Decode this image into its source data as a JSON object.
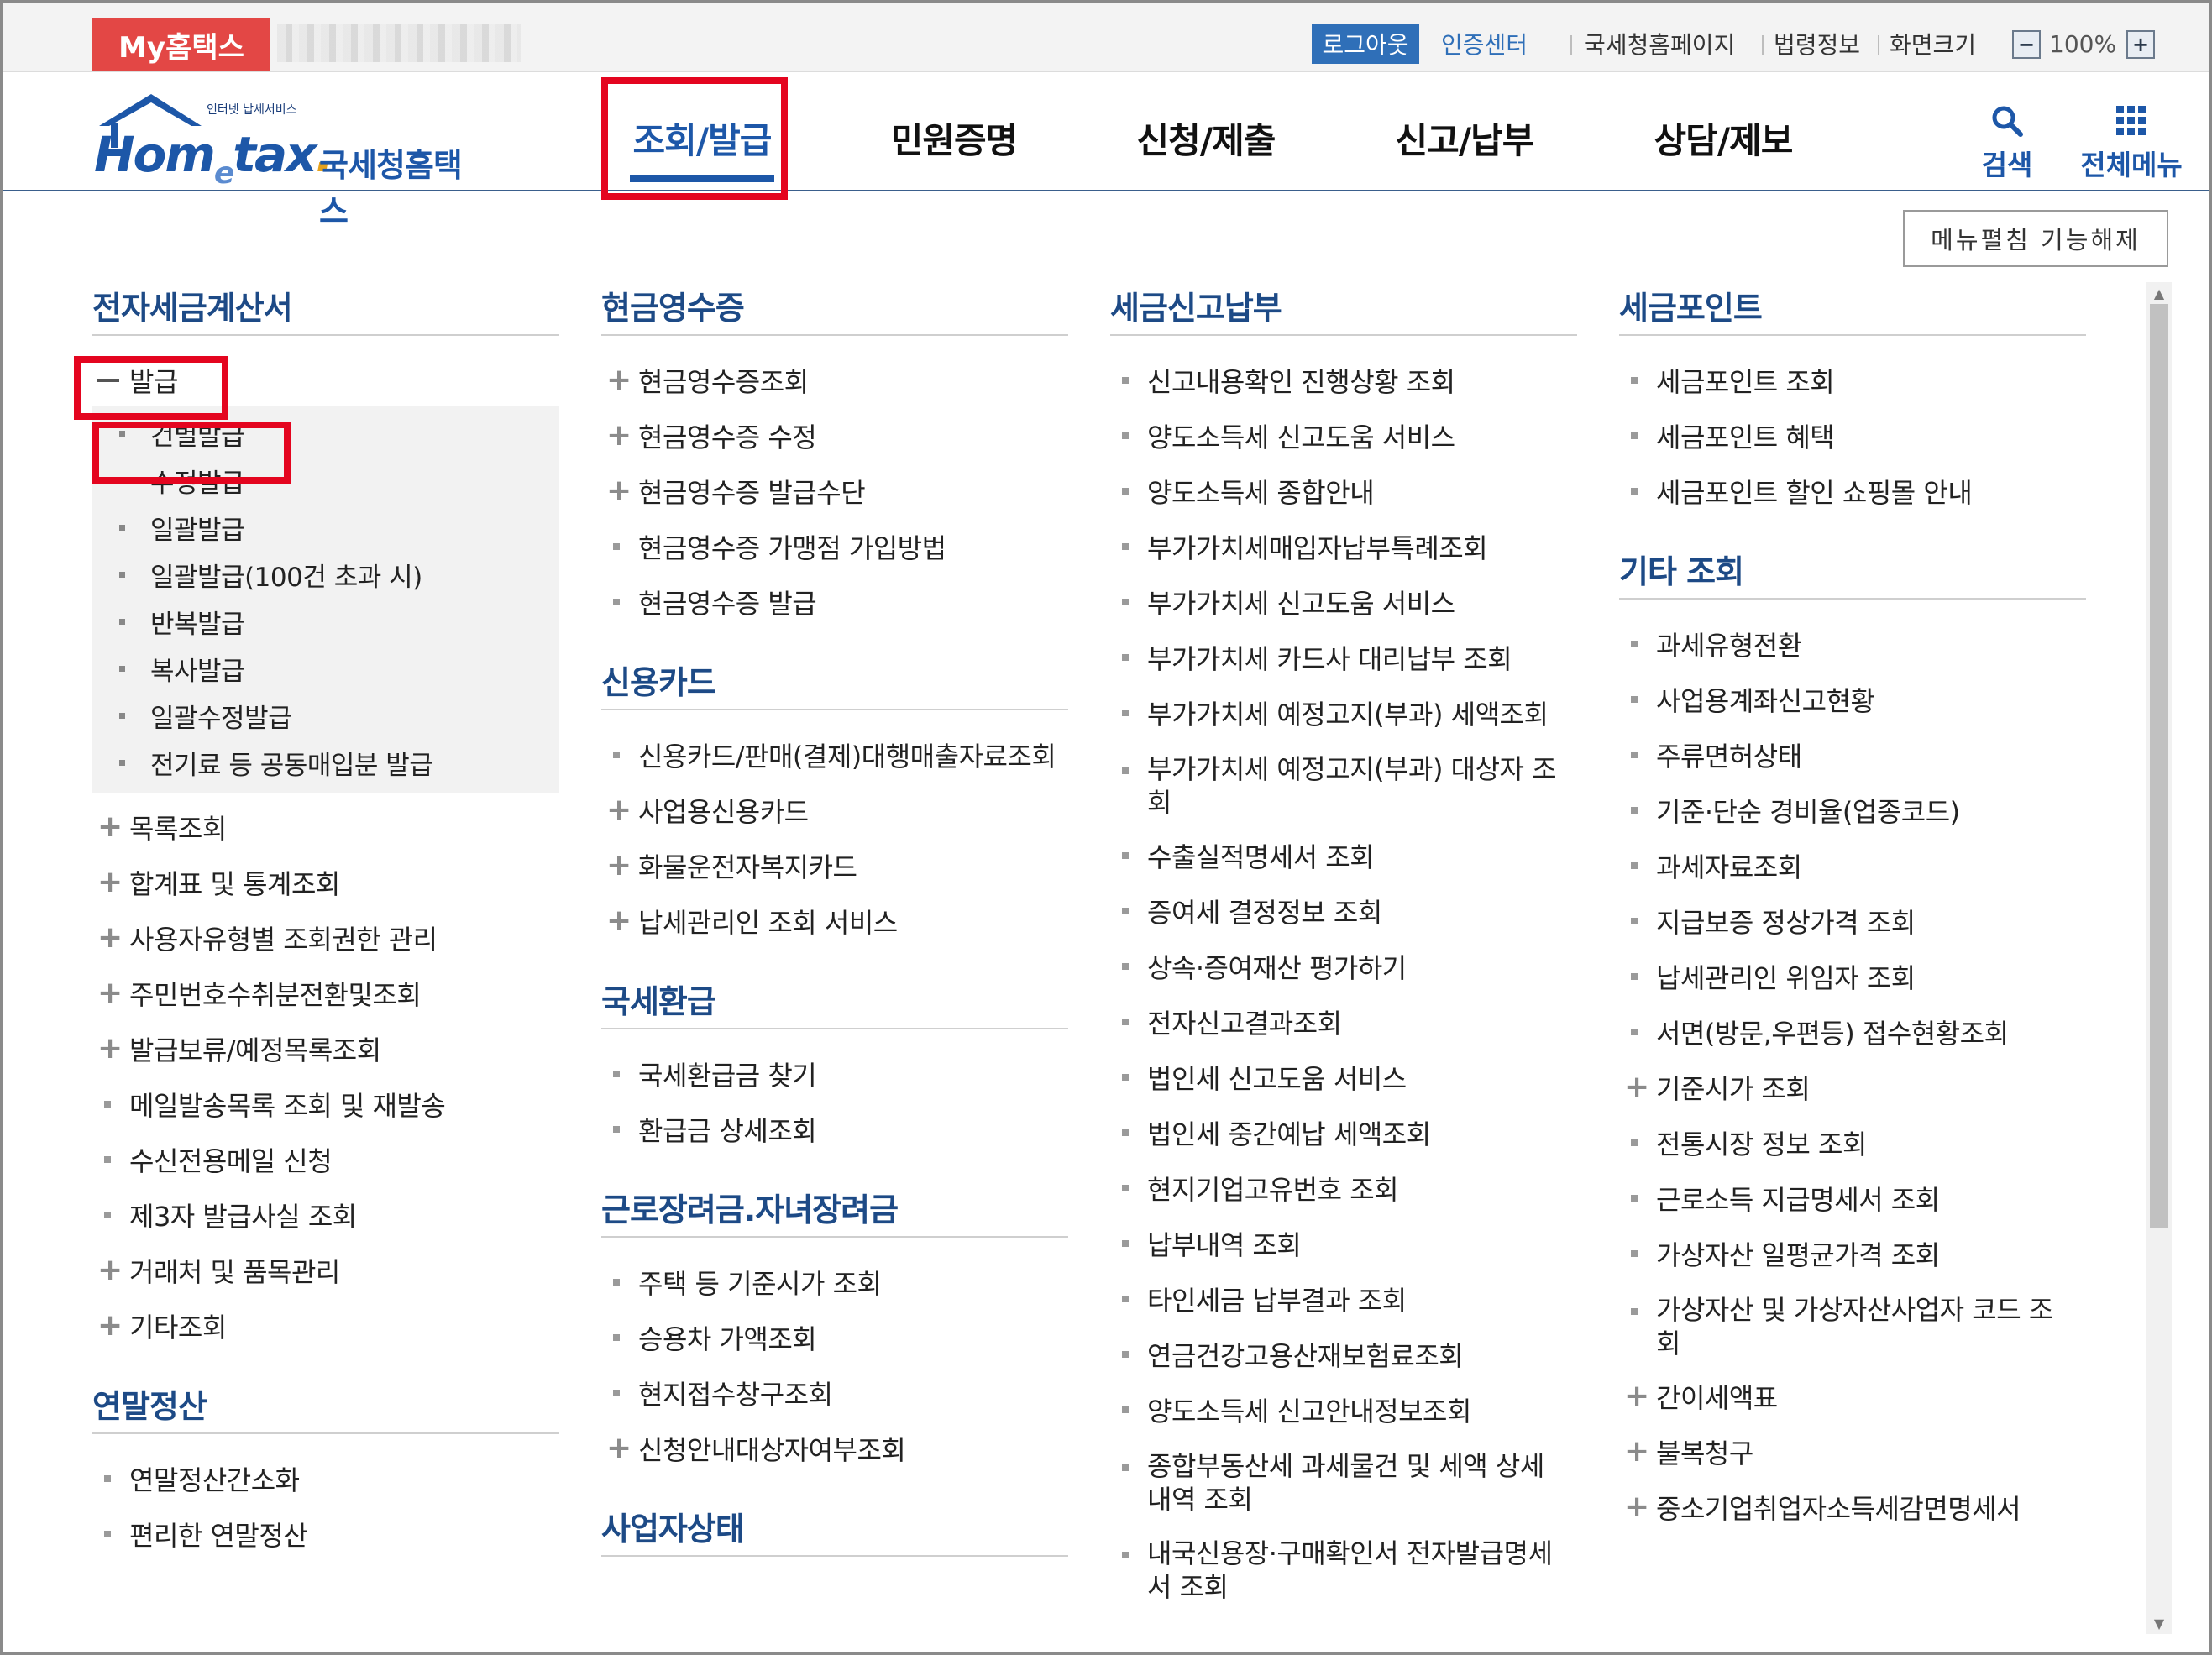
{
  "topbar": {
    "my_hometax": "My홈택스",
    "logout": "로그아웃",
    "cert_center": "인증센터",
    "links": [
      "국세청홈페이지",
      "법령정보",
      "화면크기"
    ],
    "zoom_minus": "−",
    "zoom_plus": "+",
    "zoom_value": "100%"
  },
  "logo": {
    "small": "인터넷 납세서비스",
    "home": "Hom",
    "e": "e",
    "tax": "tax",
    "dot": ".",
    "kr": "국세청홈택스"
  },
  "nav": {
    "items": [
      "조회/발급",
      "민원증명",
      "신청/제출",
      "신고/납부",
      "상담/제보"
    ],
    "active_index": 0,
    "search": "검색",
    "all_menu": "전체메뉴"
  },
  "menu_toggle": "메뉴펼침 기능해제",
  "colors": {
    "brand_blue": "#1d57a8",
    "section_blue": "#1d4a86",
    "highlight_red": "#e4051f",
    "my_hometax_red": "#e34745"
  },
  "col1": {
    "sec1_title": "전자세금계산서",
    "expanded_label": "발급",
    "sub_items": [
      "건별발급",
      "수정발급",
      "일괄발급",
      "일괄발급(100건 초과 시)",
      "반복발급",
      "복사발급",
      "일괄수정발급",
      "전기료 등 공동매입분 발급"
    ],
    "items": [
      {
        "label": "목록조회",
        "icon": "plus"
      },
      {
        "label": "합계표 및 통계조회",
        "icon": "plus"
      },
      {
        "label": "사용자유형별 조회권한 관리",
        "icon": "plus"
      },
      {
        "label": "주민번호수취분전환및조회",
        "icon": "plus"
      },
      {
        "label": "발급보류/예정목록조회",
        "icon": "plus"
      },
      {
        "label": "메일발송목록 조회 및 재발송",
        "icon": "bullet"
      },
      {
        "label": "수신전용메일 신청",
        "icon": "bullet"
      },
      {
        "label": "제3자 발급사실 조회",
        "icon": "bullet"
      },
      {
        "label": "거래처 및 품목관리",
        "icon": "plus"
      },
      {
        "label": "기타조회",
        "icon": "plus"
      }
    ],
    "sec2_title": "연말정산",
    "sec2_items": [
      "연말정산간소화",
      "편리한 연말정산"
    ]
  },
  "col2": {
    "sec1_title": "현금영수증",
    "sec1_items": [
      {
        "label": "현금영수증조회",
        "icon": "plus"
      },
      {
        "label": "현금영수증 수정",
        "icon": "plus"
      },
      {
        "label": "현금영수증 발급수단",
        "icon": "plus"
      },
      {
        "label": "현금영수증 가맹점 가입방법",
        "icon": "bullet"
      },
      {
        "label": "현금영수증 발급",
        "icon": "bullet"
      }
    ],
    "sec2_title": "신용카드",
    "sec2_items": [
      {
        "label": "신용카드/판매(결제)대행매출자료조회",
        "icon": "bullet"
      },
      {
        "label": "사업용신용카드",
        "icon": "plus"
      },
      {
        "label": "화물운전자복지카드",
        "icon": "plus"
      },
      {
        "label": "납세관리인 조회 서비스",
        "icon": "plus"
      }
    ],
    "sec3_title": "국세환급",
    "sec3_items": [
      {
        "label": "국세환급금 찾기",
        "icon": "bullet"
      },
      {
        "label": "환급금 상세조회",
        "icon": "bullet"
      }
    ],
    "sec4_title": "근로장려금.자녀장려금",
    "sec4_items": [
      {
        "label": "주택 등 기준시가 조회",
        "icon": "bullet"
      },
      {
        "label": "승용차 가액조회",
        "icon": "bullet"
      },
      {
        "label": "현지접수창구조회",
        "icon": "bullet"
      },
      {
        "label": "신청안내대상자여부조회",
        "icon": "plus"
      }
    ],
    "sec5_title": "사업자상태"
  },
  "col3": {
    "sec1_title": "세금신고납부",
    "items": [
      "신고내용확인 진행상황 조회",
      "양도소득세 신고도움 서비스",
      "양도소득세 종합안내",
      "부가가치세매입자납부특례조회",
      "부가가치세 신고도움 서비스",
      "부가가치세 카드사 대리납부 조회",
      "부가가치세 예정고지(부과) 세액조회",
      "부가가치세 예정고지(부과) 대상자 조회",
      "수출실적명세서 조회",
      "증여세 결정정보 조회",
      "상속·증여재산 평가하기",
      "전자신고결과조회",
      "법인세 신고도움 서비스",
      "법인세 중간예납 세액조회",
      "현지기업고유번호 조회",
      "납부내역 조회",
      "타인세금 납부결과 조회",
      "연금건강고용산재보험료조회",
      "양도소득세 신고안내정보조회",
      "종합부동산세 과세물건 및 세액 상세내역 조회",
      "내국신용장·구매확인서 전자발급명세서 조회"
    ]
  },
  "col4": {
    "sec1_title": "세금포인트",
    "sec1_items": [
      "세금포인트 조회",
      "세금포인트 혜택",
      "세금포인트 할인 쇼핑몰 안내"
    ],
    "sec2_title": "기타 조회",
    "sec2_items": [
      {
        "label": "과세유형전환",
        "icon": "bullet"
      },
      {
        "label": "사업용계좌신고현황",
        "icon": "bullet"
      },
      {
        "label": "주류면허상태",
        "icon": "bullet"
      },
      {
        "label": "기준·단순 경비율(업종코드)",
        "icon": "bullet"
      },
      {
        "label": "과세자료조회",
        "icon": "bullet"
      },
      {
        "label": "지급보증 정상가격 조회",
        "icon": "bullet"
      },
      {
        "label": "납세관리인 위임자 조회",
        "icon": "bullet"
      },
      {
        "label": "서면(방문,우편등) 접수현황조회",
        "icon": "bullet"
      },
      {
        "label": "기준시가 조회",
        "icon": "plus"
      },
      {
        "label": "전통시장 정보 조회",
        "icon": "bullet"
      },
      {
        "label": "근로소득 지급명세서 조회",
        "icon": "bullet"
      },
      {
        "label": "가상자산 일평균가격 조회",
        "icon": "bullet"
      },
      {
        "label": "가상자산 및 가상자산사업자 코드 조회",
        "icon": "bullet"
      },
      {
        "label": "간이세액표",
        "icon": "plus"
      },
      {
        "label": "불복청구",
        "icon": "plus"
      },
      {
        "label": "중소기업취업자소득세감면명세서",
        "icon": "plus"
      }
    ]
  }
}
